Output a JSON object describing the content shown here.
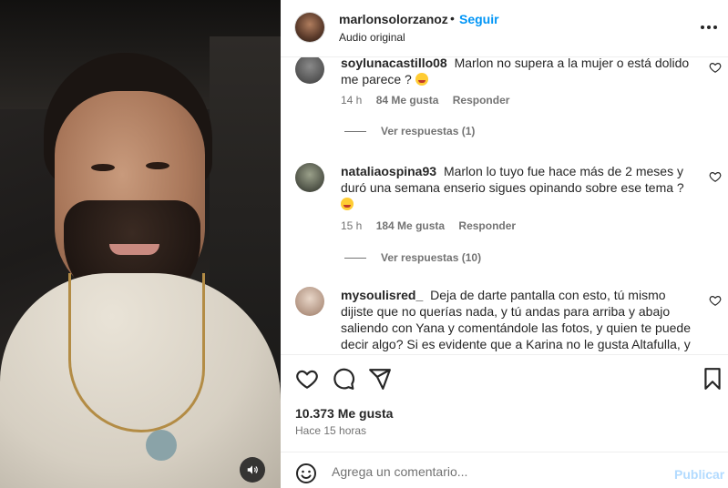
{
  "post": {
    "username": "marlonsolorzanoz",
    "separator": "•",
    "follow_label": "Seguir",
    "audio_label": "Audio original"
  },
  "comments": [
    {
      "username": "soylunacastillo08",
      "text": "Marlon no supera a la mujer o está dolido me parece ?",
      "emoji": "laughing-face",
      "time": "14 h",
      "likes": "84 Me gusta",
      "reply_label": "Responder",
      "view_replies": "Ver respuestas (1)"
    },
    {
      "username": "nataliaospina93",
      "text": "Marlon lo tuyo fue hace más de 2 meses y duró una semana enserio sigues opinando sobre ese tema ?",
      "emoji": "laughing-face",
      "time": "15 h",
      "likes": "184 Me gusta",
      "reply_label": "Responder",
      "view_replies": "Ver respuestas (10)"
    },
    {
      "username": "mysoulisred_",
      "text": "Deja de darte pantalla con esto, tú mismo dijiste que no querías nada, y tú andas para arriba y abajo saliendo con Yana y comentándole las fotos, y quien te puede decir algo? Si es evidente que a Karina no le gusta Altafulla, y si él le"
    }
  ],
  "actions": {
    "likes": "10.373 Me gusta",
    "posted_ago": "Hace 15 horas"
  },
  "add_comment": {
    "placeholder": "Agrega un comentario...",
    "publish_label": "Publicar"
  },
  "colors": {
    "accent": "#0095f6",
    "publish_disabled": "#b3dbff",
    "secondary_text": "#737373"
  }
}
